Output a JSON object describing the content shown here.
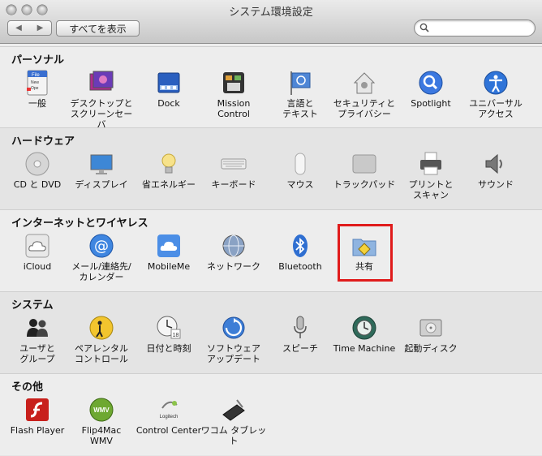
{
  "window": {
    "title": "システム環境設定"
  },
  "toolbar": {
    "back_label": "◀",
    "forward_label": "▶",
    "show_all_label": "すべてを表示",
    "search_placeholder": "",
    "search_value": ""
  },
  "sections": {
    "personal": {
      "title": "パーソナル",
      "items": [
        {
          "label": "一般"
        },
        {
          "label": "デスクトップと\nスクリーンセーバ"
        },
        {
          "label": "Dock"
        },
        {
          "label": "Mission\nControl"
        },
        {
          "label": "言語と\nテキスト"
        },
        {
          "label": "セキュリティと\nプライバシー"
        },
        {
          "label": "Spotlight"
        },
        {
          "label": "ユニバーサル\nアクセス"
        }
      ]
    },
    "hardware": {
      "title": "ハードウェア",
      "items": [
        {
          "label": "CD と DVD"
        },
        {
          "label": "ディスプレイ"
        },
        {
          "label": "省エネルギー"
        },
        {
          "label": "キーボード"
        },
        {
          "label": "マウス"
        },
        {
          "label": "トラックパッド"
        },
        {
          "label": "プリントと\nスキャン"
        },
        {
          "label": "サウンド"
        }
      ]
    },
    "internet": {
      "title": "インターネットとワイヤレス",
      "items": [
        {
          "label": "iCloud"
        },
        {
          "label": "メール/連絡先/\nカレンダー"
        },
        {
          "label": "MobileMe"
        },
        {
          "label": "ネットワーク"
        },
        {
          "label": "Bluetooth"
        },
        {
          "label": "共有"
        }
      ]
    },
    "system": {
      "title": "システム",
      "items": [
        {
          "label": "ユーザと\nグループ"
        },
        {
          "label": "ペアレンタル\nコントロール"
        },
        {
          "label": "日付と時刻"
        },
        {
          "label": "ソフトウェア\nアップデート"
        },
        {
          "label": "スピーチ"
        },
        {
          "label": "Time Machine"
        },
        {
          "label": "起動ディスク"
        }
      ]
    },
    "other": {
      "title": "その他",
      "items": [
        {
          "label": "Flash Player"
        },
        {
          "label": "Flip4Mac\nWMV"
        },
        {
          "label": "Control Center"
        },
        {
          "label": "ワコム タブレット"
        }
      ]
    }
  },
  "icon_text": {
    "general_file": "File",
    "general_new": "New",
    "general_open": "Ope",
    "date_day": "18",
    "wmv": "WMV",
    "logitech": "Logitech"
  }
}
